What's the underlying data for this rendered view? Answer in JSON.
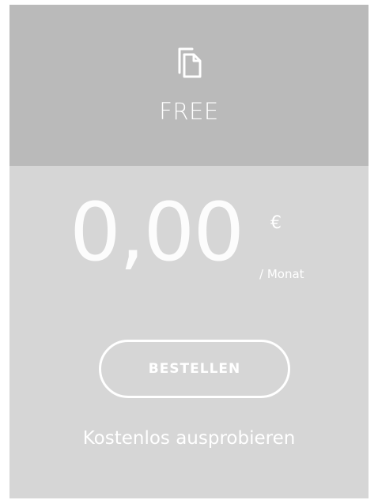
{
  "plan": {
    "icon": "document-copy-icon",
    "name": "FREE",
    "price": "0,00",
    "currency": "€",
    "period": "/ Monat",
    "button_label": "BESTELLEN",
    "trial_text": "Kostenlos ausprobieren"
  },
  "colors": {
    "header_bg": "#bababa",
    "body_bg": "#d6d6d6",
    "text": "#ffffff"
  }
}
